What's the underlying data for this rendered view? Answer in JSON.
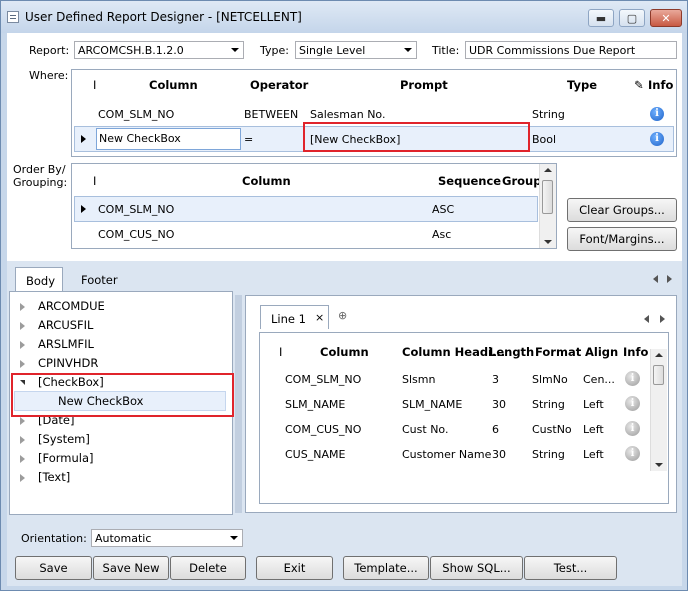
{
  "window": {
    "title": "User Defined Report Designer - [NETCELLENT]",
    "min": "▬",
    "max": "▢",
    "close": "✕"
  },
  "header": {
    "report_label": "Report:",
    "report_value": "ARCOMCSH.B.1.2.0",
    "type_label": "Type:",
    "type_value": "Single Level",
    "title_label": "Title:",
    "title_value": "UDR Commissions Due Report"
  },
  "where": {
    "label": "Where:",
    "columns": [
      "Column",
      "Operator",
      "Prompt",
      "Type",
      "Info"
    ],
    "rows": [
      {
        "column": "COM_SLM_NO",
        "operator": "BETWEEN",
        "prompt": "Salesman No.",
        "type": "String"
      },
      {
        "column": "New CheckBox",
        "operator": "=",
        "prompt": "[New CheckBox]",
        "type": "Bool"
      }
    ]
  },
  "orderby": {
    "label1": "Order By/",
    "label2": "Grouping:",
    "columns": [
      "Column",
      "Sequence",
      "Group"
    ],
    "rows": [
      {
        "column": "COM_SLM_NO",
        "sequence": "ASC"
      },
      {
        "column": "COM_CUS_NO",
        "sequence": "Asc"
      }
    ],
    "clear_groups": "Clear Groups...",
    "font_margins": "Font/Margins..."
  },
  "tabs": {
    "body": "Body",
    "footer": "Footer"
  },
  "tree": {
    "items": [
      "ARCOMDUE",
      "ARCUSFIL",
      "ARSLMFIL",
      "CPINVHDR",
      "[CheckBox]",
      "[Date]",
      "[System]",
      "[Formula]",
      "[Text]"
    ],
    "child": "New CheckBox"
  },
  "line_tab": {
    "label": "Line 1",
    "close": "×",
    "add": "⊕"
  },
  "fields": {
    "columns": [
      "Column",
      "Column Headi...",
      "Length",
      "Format",
      "Align",
      "Info"
    ],
    "rows": [
      {
        "column": "COM_SLM_NO",
        "heading": "Slsmn",
        "length": "3",
        "format": "SlmNo",
        "align": "Cen..."
      },
      {
        "column": "SLM_NAME",
        "heading": "SLM_NAME",
        "length": "30",
        "format": "String",
        "align": "Left"
      },
      {
        "column": "COM_CUS_NO",
        "heading": "Cust No.",
        "length": "6",
        "format": "CustNo",
        "align": "Left"
      },
      {
        "column": "CUS_NAME",
        "heading": "Customer Name",
        "length": "30",
        "format": "String",
        "align": "Left"
      }
    ]
  },
  "footer": {
    "orientation_label": "Orientation:",
    "orientation_value": "Automatic",
    "buttons": [
      "Save",
      "Save New",
      "Delete",
      "Exit",
      "Template...",
      "Show SQL...",
      "Test..."
    ]
  },
  "icon_glyphs": {
    "info": "i",
    "edit": "✎"
  }
}
